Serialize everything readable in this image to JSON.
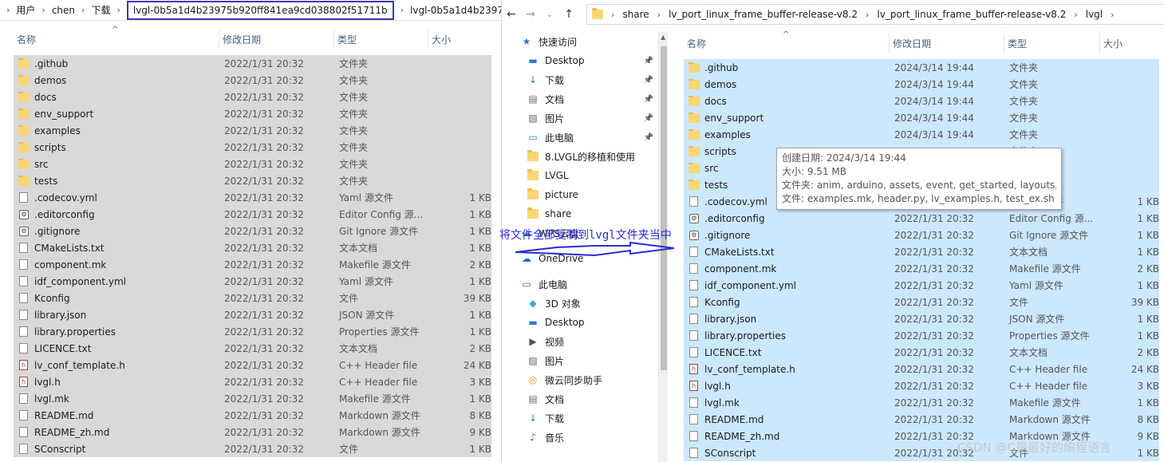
{
  "left": {
    "breadcrumbs": [
      "用户",
      "chen",
      "下载",
      "lvgl-0b5a1d4b23975b920ff841ea9cd038802f51711b",
      "lvgl-0b5a1d4b23975"
    ],
    "highlight_color": "#3a3ab0",
    "columns": {
      "name": "名称",
      "date": "修改日期",
      "type": "类型",
      "size": "大小"
    },
    "files": [
      {
        "icon": "folder",
        "name": ".github",
        "date": "2022/1/31 20:32",
        "type": "文件夹",
        "size": ""
      },
      {
        "icon": "folder",
        "name": "demos",
        "date": "2022/1/31 20:32",
        "type": "文件夹",
        "size": ""
      },
      {
        "icon": "folder",
        "name": "docs",
        "date": "2022/1/31 20:32",
        "type": "文件夹",
        "size": ""
      },
      {
        "icon": "folder",
        "name": "env_support",
        "date": "2022/1/31 20:32",
        "type": "文件夹",
        "size": ""
      },
      {
        "icon": "folder",
        "name": "examples",
        "date": "2022/1/31 20:32",
        "type": "文件夹",
        "size": ""
      },
      {
        "icon": "folder",
        "name": "scripts",
        "date": "2022/1/31 20:32",
        "type": "文件夹",
        "size": ""
      },
      {
        "icon": "folder",
        "name": "src",
        "date": "2022/1/31 20:32",
        "type": "文件夹",
        "size": ""
      },
      {
        "icon": "folder",
        "name": "tests",
        "date": "2022/1/31 20:32",
        "type": "文件夹",
        "size": ""
      },
      {
        "icon": "file",
        "name": ".codecov.yml",
        "date": "2022/1/31 20:32",
        "type": "Yaml 源文件",
        "size": "1 KB"
      },
      {
        "icon": "gear",
        "name": ".editorconfig",
        "date": "2022/1/31 20:32",
        "type": "Editor Config 源...",
        "size": "1 KB"
      },
      {
        "icon": "gear",
        "name": ".gitignore",
        "date": "2022/1/31 20:32",
        "type": "Git Ignore 源文件",
        "size": "1 KB"
      },
      {
        "icon": "file",
        "name": "CMakeLists.txt",
        "date": "2022/1/31 20:32",
        "type": "文本文档",
        "size": "1 KB"
      },
      {
        "icon": "file",
        "name": "component.mk",
        "date": "2022/1/31 20:32",
        "type": "Makefile 源文件",
        "size": "2 KB"
      },
      {
        "icon": "file",
        "name": "idf_component.yml",
        "date": "2022/1/31 20:32",
        "type": "Yaml 源文件",
        "size": "1 KB"
      },
      {
        "icon": "file",
        "name": "Kconfig",
        "date": "2022/1/31 20:32",
        "type": "文件",
        "size": "39 KB"
      },
      {
        "icon": "file",
        "name": "library.json",
        "date": "2022/1/31 20:32",
        "type": "JSON 源文件",
        "size": "1 KB"
      },
      {
        "icon": "file",
        "name": "library.properties",
        "date": "2022/1/31 20:32",
        "type": "Properties 源文件",
        "size": "1 KB"
      },
      {
        "icon": "file",
        "name": "LICENCE.txt",
        "date": "2022/1/31 20:32",
        "type": "文本文档",
        "size": "2 KB"
      },
      {
        "icon": "h",
        "name": "lv_conf_template.h",
        "date": "2022/1/31 20:32",
        "type": "C++ Header file",
        "size": "24 KB"
      },
      {
        "icon": "h",
        "name": "lvgl.h",
        "date": "2022/1/31 20:32",
        "type": "C++ Header file",
        "size": "3 KB"
      },
      {
        "icon": "file",
        "name": "lvgl.mk",
        "date": "2022/1/31 20:32",
        "type": "Makefile 源文件",
        "size": "1 KB"
      },
      {
        "icon": "file",
        "name": "README.md",
        "date": "2022/1/31 20:32",
        "type": "Markdown 源文件",
        "size": "8 KB"
      },
      {
        "icon": "file",
        "name": "README_zh.md",
        "date": "2022/1/31 20:32",
        "type": "Markdown 源文件",
        "size": "9 KB"
      },
      {
        "icon": "file",
        "name": "SConscript",
        "date": "2022/1/31 20:32",
        "type": "文件",
        "size": "1 KB"
      }
    ]
  },
  "right": {
    "breadcrumbs": [
      "share",
      "lv_port_linux_frame_buffer-release-v8.2",
      "lv_port_linux_frame_buffer-release-v8.2",
      "lvgl"
    ],
    "nav": [
      {
        "icon": "star",
        "label": "快速访问",
        "pinned": false
      },
      {
        "icon": "desktop",
        "label": "Desktop",
        "pinned": true
      },
      {
        "icon": "download",
        "label": "下载",
        "pinned": true
      },
      {
        "icon": "doc",
        "label": "文档",
        "pinned": true
      },
      {
        "icon": "pic",
        "label": "图片",
        "pinned": true
      },
      {
        "icon": "pc",
        "label": "此电脑",
        "pinned": true
      },
      {
        "icon": "folder",
        "label": "8.LVGL的移植和使用",
        "pinned": false
      },
      {
        "icon": "folder",
        "label": "LVGL",
        "pinned": false
      },
      {
        "icon": "folder",
        "label": "picture",
        "pinned": false
      },
      {
        "icon": "folder",
        "label": "share",
        "pinned": false
      },
      {
        "icon": "cloud",
        "label": "WPS云盘",
        "pinned": false
      },
      {
        "icon": "onedrive",
        "label": "OneDrive",
        "pinned": false
      },
      {
        "icon": "pc",
        "label": "此电脑",
        "pinned": false
      },
      {
        "icon": "3d",
        "label": "3D 对象",
        "pinned": false
      },
      {
        "icon": "desktop",
        "label": "Desktop",
        "pinned": false
      },
      {
        "icon": "video",
        "label": "视频",
        "pinned": false
      },
      {
        "icon": "pic",
        "label": "图片",
        "pinned": false
      },
      {
        "icon": "sync",
        "label": "微云同步助手",
        "pinned": false
      },
      {
        "icon": "doc",
        "label": "文档",
        "pinned": false
      },
      {
        "icon": "download",
        "label": "下载",
        "pinned": false
      },
      {
        "icon": "music",
        "label": "音乐",
        "pinned": false
      }
    ],
    "columns": {
      "name": "名称",
      "date": "修改日期",
      "type": "类型",
      "size": "大小"
    },
    "files": [
      {
        "icon": "folder",
        "name": ".github",
        "date": "2024/3/14 19:44",
        "type": "文件夹",
        "size": ""
      },
      {
        "icon": "folder",
        "name": "demos",
        "date": "2024/3/14 19:44",
        "type": "文件夹",
        "size": ""
      },
      {
        "icon": "folder",
        "name": "docs",
        "date": "2024/3/14 19:44",
        "type": "文件夹",
        "size": ""
      },
      {
        "icon": "folder",
        "name": "env_support",
        "date": "2024/3/14 19:44",
        "type": "文件夹",
        "size": ""
      },
      {
        "icon": "folder",
        "name": "examples",
        "date": "2024/3/14 19:44",
        "type": "文件夹",
        "size": ""
      },
      {
        "icon": "folder",
        "name": "scripts",
        "date": "2024/3/14 19:44",
        "type": "文件夹",
        "size": ""
      },
      {
        "icon": "folder",
        "name": "src",
        "date": "2024/3/14 19:44",
        "type": "文件夹",
        "size": ""
      },
      {
        "icon": "folder",
        "name": "tests",
        "date": "2024/3/14 19:44",
        "type": "文件夹",
        "size": ""
      },
      {
        "icon": "file",
        "name": ".codecov.yml",
        "date": "2022/1/31 20:32",
        "type": "Yaml 源文件",
        "size": "1 KB"
      },
      {
        "icon": "gear",
        "name": ".editorconfig",
        "date": "2022/1/31 20:32",
        "type": "Editor Config 源...",
        "size": "1 KB"
      },
      {
        "icon": "gear",
        "name": ".gitignore",
        "date": "2022/1/31 20:32",
        "type": "Git Ignore 源文件",
        "size": "1 KB"
      },
      {
        "icon": "file",
        "name": "CMakeLists.txt",
        "date": "2022/1/31 20:32",
        "type": "文本文档",
        "size": "1 KB"
      },
      {
        "icon": "file",
        "name": "component.mk",
        "date": "2022/1/31 20:32",
        "type": "Makefile 源文件",
        "size": "2 KB"
      },
      {
        "icon": "file",
        "name": "idf_component.yml",
        "date": "2022/1/31 20:32",
        "type": "Yaml 源文件",
        "size": "1 KB"
      },
      {
        "icon": "file",
        "name": "Kconfig",
        "date": "2022/1/31 20:32",
        "type": "文件",
        "size": "39 KB"
      },
      {
        "icon": "file",
        "name": "library.json",
        "date": "2022/1/31 20:32",
        "type": "JSON 源文件",
        "size": "1 KB"
      },
      {
        "icon": "file",
        "name": "library.properties",
        "date": "2022/1/31 20:32",
        "type": "Properties 源文件",
        "size": "1 KB"
      },
      {
        "icon": "file",
        "name": "LICENCE.txt",
        "date": "2022/1/31 20:32",
        "type": "文本文档",
        "size": "2 KB"
      },
      {
        "icon": "h",
        "name": "lv_conf_template.h",
        "date": "2022/1/31 20:32",
        "type": "C++ Header file",
        "size": "24 KB"
      },
      {
        "icon": "h",
        "name": "lvgl.h",
        "date": "2022/1/31 20:32",
        "type": "C++ Header file",
        "size": "3 KB"
      },
      {
        "icon": "file",
        "name": "lvgl.mk",
        "date": "2022/1/31 20:32",
        "type": "Makefile 源文件",
        "size": "1 KB"
      },
      {
        "icon": "file",
        "name": "README.md",
        "date": "2022/1/31 20:32",
        "type": "Markdown 源文件",
        "size": "8 KB"
      },
      {
        "icon": "file",
        "name": "README_zh.md",
        "date": "2022/1/31 20:32",
        "type": "Markdown 源文件",
        "size": "9 KB"
      },
      {
        "icon": "file",
        "name": "SConscript",
        "date": "2022/1/31 20:32",
        "type": "文件",
        "size": "1 KB"
      }
    ],
    "tooltip": [
      "创建日期: 2024/3/14 19:44",
      "大小: 9.51 MB",
      "文件夹: anim, arduino, assets, event, get_started, layouts, ...",
      "文件: examples.mk, header.py, lv_examples.h, test_ex.sh"
    ]
  },
  "annotation": {
    "text": "将文件全部复制到lvgl文件夹当中",
    "color": "#2b2bd4"
  },
  "watermark": "CSDN @C是最好的编程语言",
  "selection_colors": {
    "left": "#d9d9d9",
    "right": "#cce8ff"
  }
}
